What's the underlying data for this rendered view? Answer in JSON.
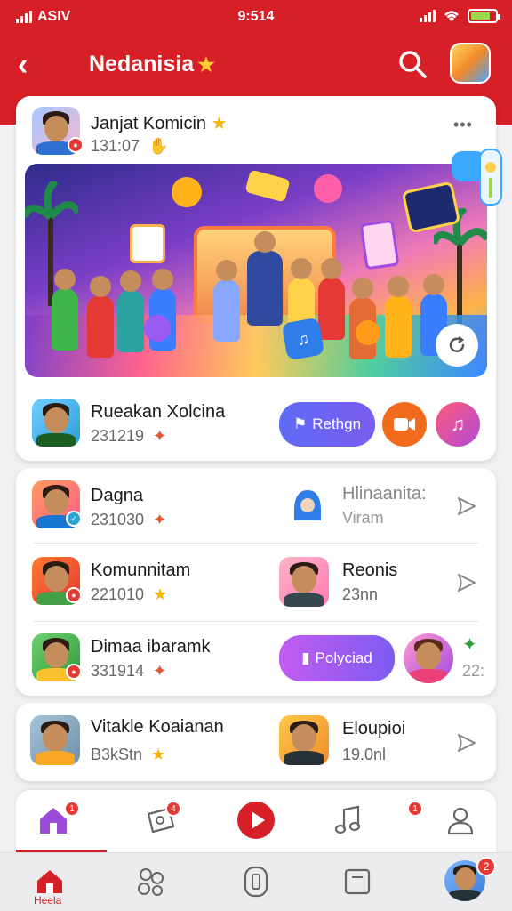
{
  "status": {
    "carrier": "ASIV",
    "time": "9:514"
  },
  "appbar": {
    "title": "Nedanisia"
  },
  "featured": {
    "author": "Janjat Komicin",
    "meta": "131:07",
    "more": "•••",
    "creator": "Rueakan Xolcina",
    "creator_meta": "231219",
    "action_label": "Rethgn"
  },
  "list_card_1": [
    {
      "name": "Dagna",
      "meta": "231030",
      "peer_name": "Hlinaanita:",
      "peer_meta": "Viram"
    },
    {
      "name": "Komunnitam",
      "meta": "221010",
      "peer_name": "Reonis",
      "peer_meta": "23nn"
    },
    {
      "name": "Dimaa ibaramk",
      "meta": "331914",
      "pill_label": "Polyciad",
      "extra_meta": "22:"
    }
  ],
  "list_card_2": [
    {
      "name": "Vitakle Koaianan",
      "meta": "B3kStn",
      "peer_name": "Eloupioi",
      "peer_meta": "19.0nl"
    }
  ],
  "tabbar": {
    "badge_home": "1",
    "badge_group": "4",
    "badge_music": "1"
  },
  "navbar": {
    "home_label": "Heela",
    "avatar_badge": "2"
  },
  "colors": {
    "brand_red": "#d61f26",
    "accent_purple": "#6a5cf0",
    "accent_orange": "#f26a1b"
  }
}
